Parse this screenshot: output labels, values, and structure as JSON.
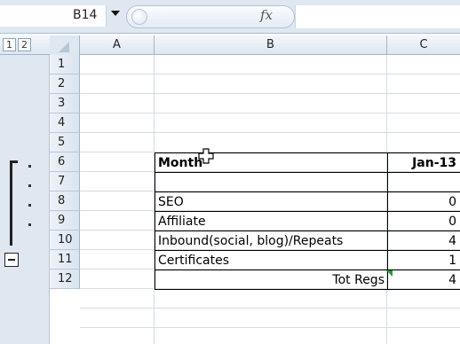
{
  "formula_bar": {
    "name_box": "B14",
    "fx_label": "fx",
    "formula": ""
  },
  "outline_levels": [
    "1",
    "2"
  ],
  "columns": [
    "A",
    "B",
    "C"
  ],
  "rows": [
    "1",
    "2",
    "3",
    "4",
    "5",
    "6",
    "7",
    "8",
    "9",
    "10",
    "11",
    "12"
  ],
  "table": {
    "header": {
      "label": "Month",
      "value": "Jan-13"
    },
    "r6": {
      "label": "",
      "value": ""
    },
    "r7": {
      "label": "SEO",
      "value": "0"
    },
    "r8": {
      "label": "Affiliate",
      "value": "0"
    },
    "r9": {
      "label": "Inbound(social, blog)/Repeats",
      "value": "4"
    },
    "r10": {
      "label": "Certificates",
      "value": "1"
    },
    "r11": {
      "label": "Tot Regs",
      "value": "4"
    }
  }
}
